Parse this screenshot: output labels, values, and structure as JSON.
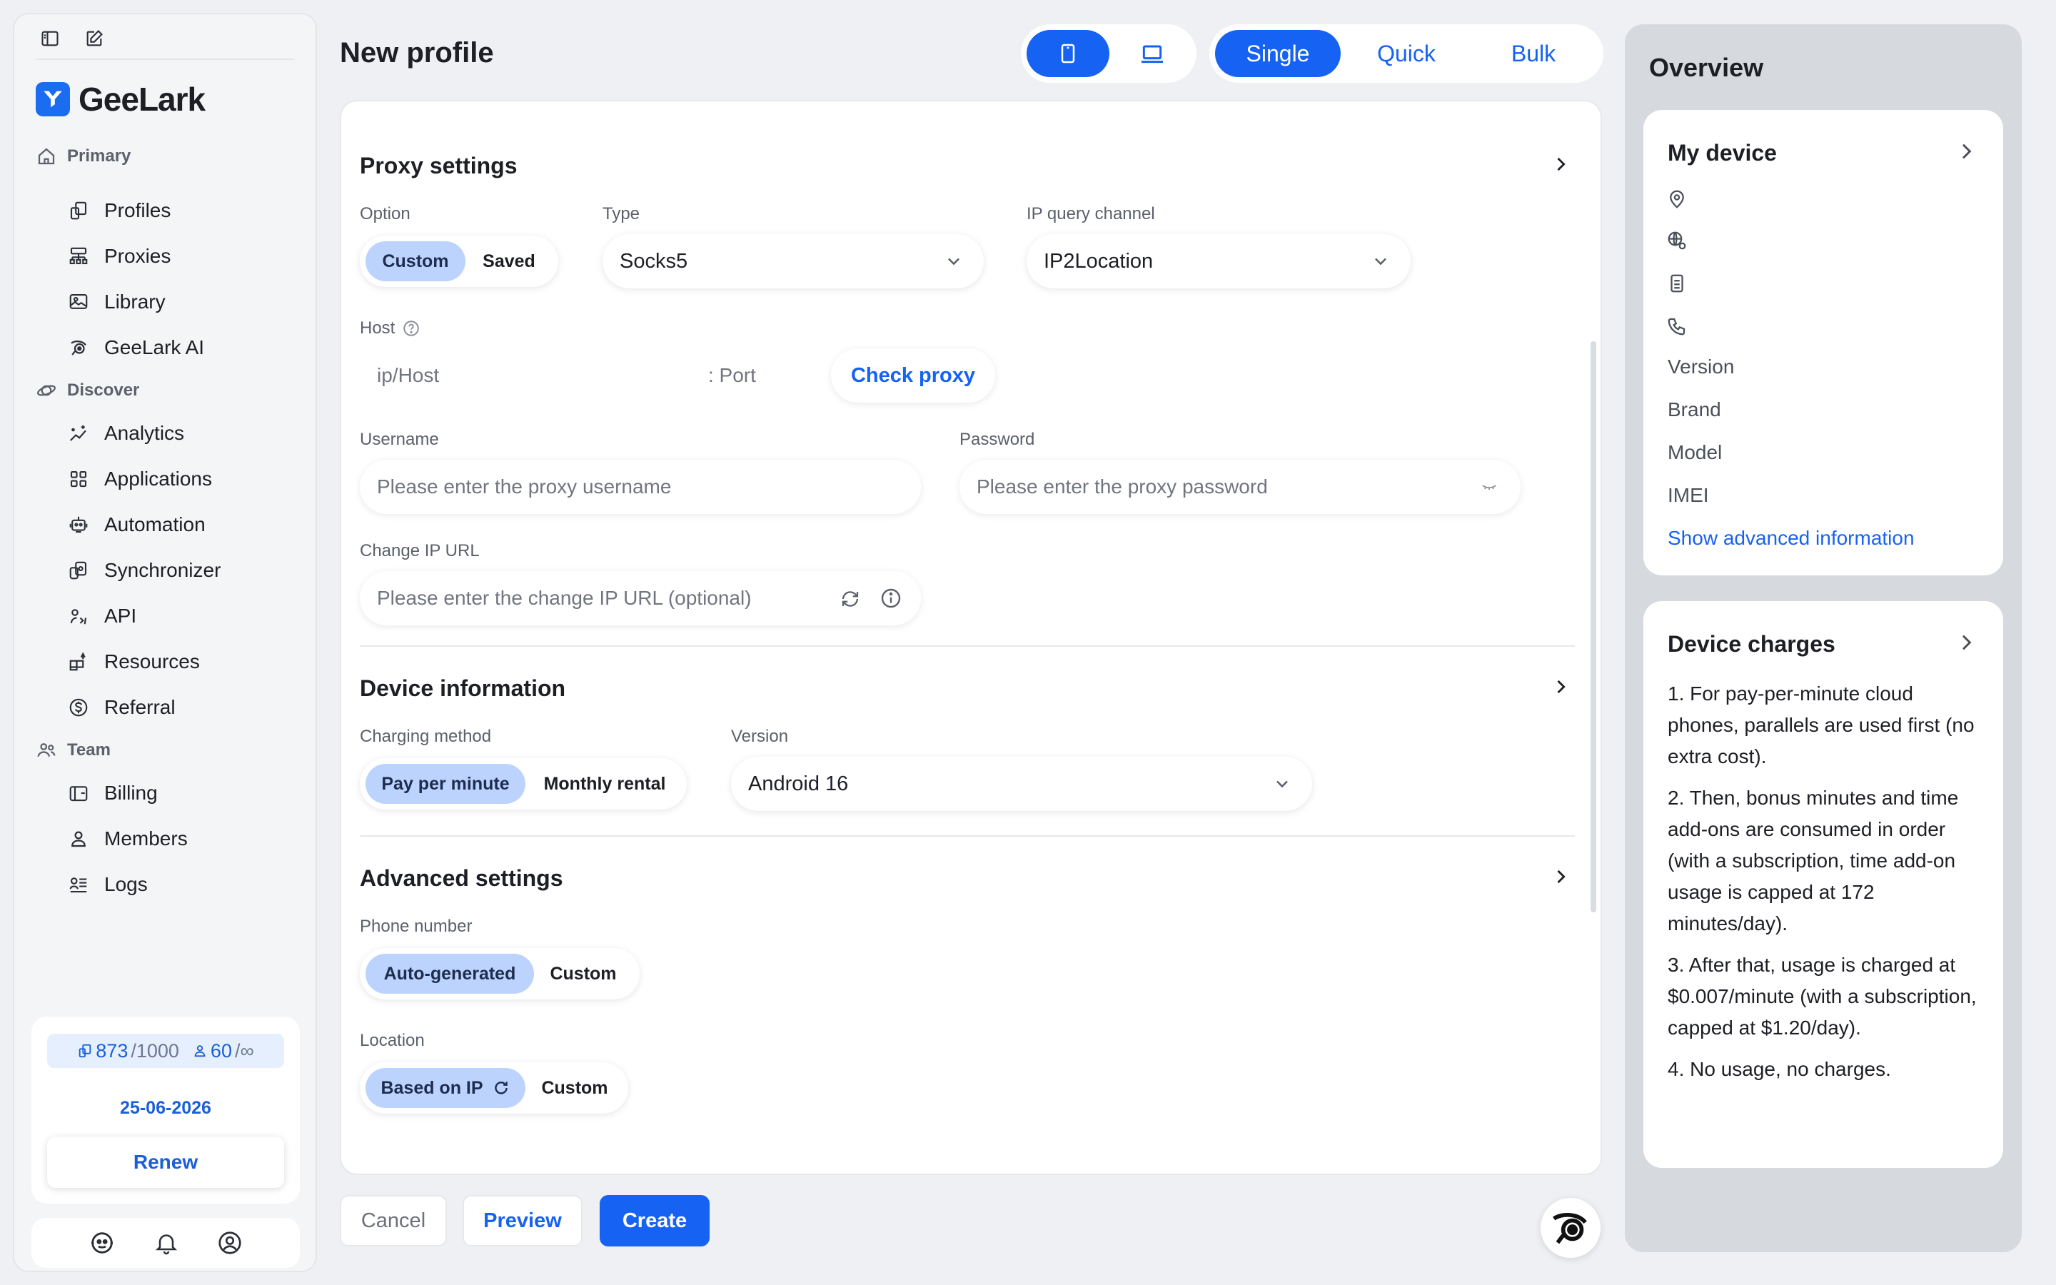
{
  "sidebar": {
    "brand": "GeeLark",
    "sections": [
      {
        "label": "Primary",
        "items": [
          "Profiles",
          "Proxies",
          "Library",
          "GeeLark AI"
        ]
      },
      {
        "label": "Discover",
        "items": [
          "Analytics",
          "Applications",
          "Automation",
          "Synchronizer",
          "API",
          "Resources",
          "Referral"
        ]
      },
      {
        "label": "Team",
        "items": [
          "Billing",
          "Members",
          "Logs"
        ]
      }
    ],
    "usage": {
      "profiles_used": "873",
      "profiles_total": "/1000",
      "members_used": "60",
      "members_total": "/∞",
      "date": "25-06-2026",
      "renew_label": "Renew"
    }
  },
  "header": {
    "title": "New profile",
    "modes": [
      "Single",
      "Quick",
      "Bulk"
    ],
    "active_mode": "Single"
  },
  "proxy": {
    "title": "Proxy settings",
    "option_label": "Option",
    "option_choices": [
      "Custom",
      "Saved"
    ],
    "type_label": "Type",
    "type_value": "Socks5",
    "ip_channel_label": "IP query channel",
    "ip_channel_value": "IP2Location",
    "host_label": "Host",
    "host_placeholder": "ip/Host",
    "port_placeholder": ": Port",
    "check_label": "Check proxy",
    "username_label": "Username",
    "username_placeholder": "Please enter the proxy username",
    "password_label": "Password",
    "password_placeholder": "Please enter the proxy password",
    "change_ip_label": "Change IP URL",
    "change_ip_placeholder": "Please enter the change IP URL (optional)"
  },
  "device_info": {
    "title": "Device information",
    "charging_label": "Charging method",
    "charging_choices": [
      "Pay per minute",
      "Monthly rental"
    ],
    "version_label": "Version",
    "version_value": "Android 16"
  },
  "advanced": {
    "title": "Advanced settings",
    "phone_label": "Phone number",
    "phone_choices": [
      "Auto-generated",
      "Custom"
    ],
    "location_label": "Location",
    "location_choices": [
      "Based on IP",
      "Custom"
    ]
  },
  "footer": {
    "cancel": "Cancel",
    "preview": "Preview",
    "create": "Create"
  },
  "overview": {
    "title": "Overview",
    "my_device": {
      "title": "My device",
      "fields": [
        "Version",
        "Brand",
        "Model",
        "IMEI"
      ],
      "link": "Show advanced information"
    },
    "charges": {
      "title": "Device charges",
      "items": [
        "1. For pay-per-minute cloud phones, parallels are used first (no extra cost).",
        "2. Then, bonus minutes and time add-ons are consumed in order (with a subscription, time add-on usage is capped at 172 minutes/day).",
        "3. After that, usage is charged at $0.007/minute (with a subscription, capped at $1.20/day).",
        "4. No usage, no charges."
      ]
    }
  },
  "colors": {
    "accent": "#1662f3",
    "selected_pill": "#bcd3fd",
    "background": "#eef0f3"
  }
}
